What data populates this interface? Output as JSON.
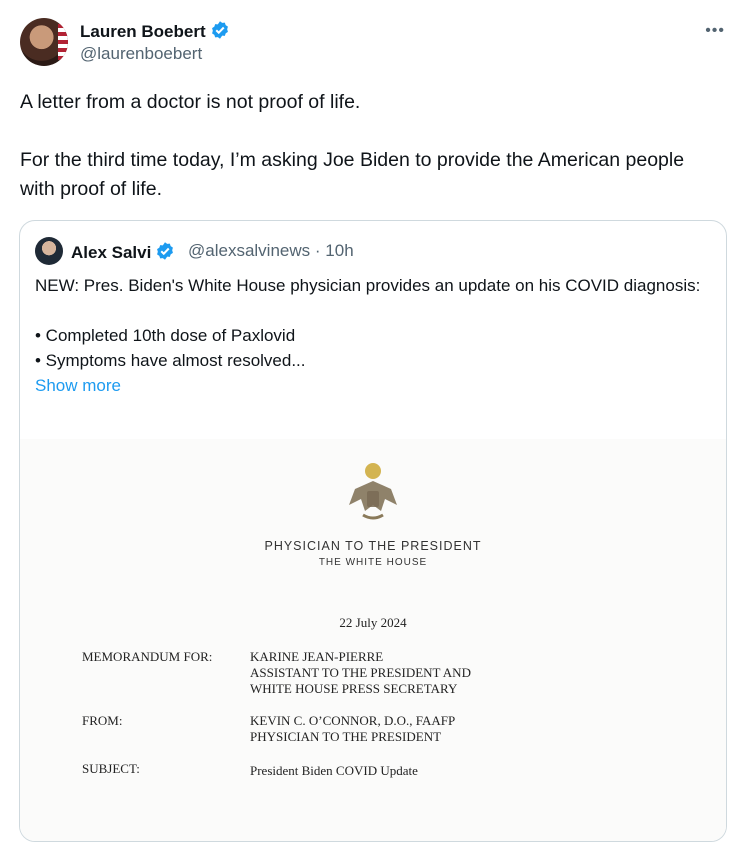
{
  "author": {
    "name": "Lauren Boebert",
    "handle": "@laurenboebert",
    "more_label": "•••"
  },
  "tweet": {
    "paragraphs": [
      "A letter from a doctor is not proof of life.",
      "For the third time today, I’m asking Joe Biden to provide the American people with proof of life."
    ]
  },
  "quote": {
    "name": "Alex Salvi",
    "handle": "@alexsalvinews",
    "separator": "·",
    "time": "10h",
    "lines": [
      "NEW: Pres. Biden's White House physician provides an update on his COVID diagnosis:",
      "• Completed 10th dose of Paxlovid",
      "• Symptoms have almost resolved..."
    ],
    "show_more": "Show more"
  },
  "document": {
    "heading": "PHYSICIAN TO THE PRESIDENT",
    "subheading": "THE WHITE HOUSE",
    "date": "22 July 2024",
    "memo_label": "MEMORANDUM FOR:",
    "memo_lines": [
      "KARINE JEAN-PIERRE",
      "ASSISTANT TO THE PRESIDENT AND",
      "WHITE HOUSE PRESS SECRETARY"
    ],
    "from_label": "FROM:",
    "from_lines": [
      "KEVIN C. O’CONNOR, D.O., FAAFP",
      "PHYSICIAN TO THE PRESIDENT"
    ],
    "subject_label": "SUBJECT:",
    "subject_value": "President Biden COVID Update"
  },
  "colors": {
    "verified": "#1d9bf0",
    "link": "#1d9bf0",
    "muted": "#536471"
  }
}
